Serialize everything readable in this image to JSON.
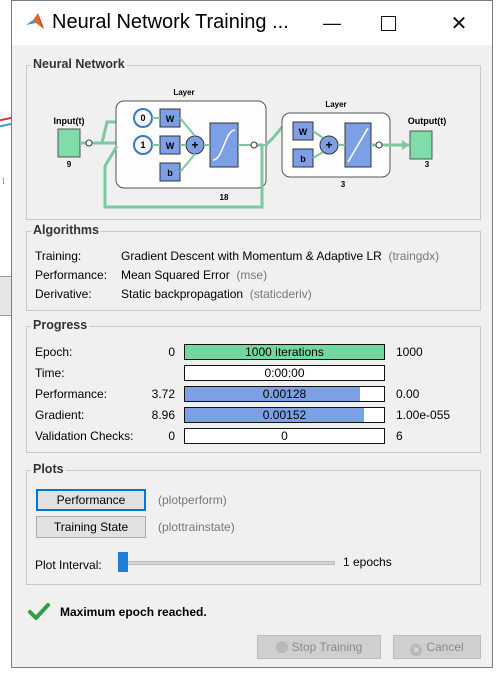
{
  "window": {
    "title": "Neural Network Training ..."
  },
  "network": {
    "section_title": "Neural Network",
    "input_label": "Input(t)",
    "input_size": "9",
    "hidden_layer_label": "Layer",
    "hidden_size": "18",
    "delay_0": "0",
    "delay_1": "1",
    "w": "W",
    "b": "b",
    "output_layer_label": "Layer",
    "output_layer_size": "3",
    "output_label": "Output(t)",
    "output_size": "3"
  },
  "algorithms": {
    "section_title": "Algorithms",
    "rows": [
      {
        "label": "Training:",
        "value": "Gradient Descent with Momentum & Adaptive LR",
        "code": "(traingdx)"
      },
      {
        "label": "Performance:",
        "value": "Mean Squared Error",
        "code": "(mse)"
      },
      {
        "label": "Derivative:",
        "value": "Static backpropagation",
        "code": "(staticderiv)"
      }
    ]
  },
  "progress": {
    "section_title": "Progress",
    "rows": [
      {
        "label": "Epoch:",
        "start": "0",
        "text": "1000 iterations",
        "end": "1000",
        "fill": 1.0,
        "color": "#72d8a0"
      },
      {
        "label": "Time:",
        "start": "",
        "text": "0:00:00",
        "end": "",
        "fill": 0.0,
        "color": "#ffffff"
      },
      {
        "label": "Performance:",
        "start": "3.72",
        "text": "0.00128",
        "end": "0.00",
        "fill": 0.88,
        "color": "#7d9fe6"
      },
      {
        "label": "Gradient:",
        "start": "8.96",
        "text": "0.00152",
        "end": "1.00e-055",
        "fill": 0.9,
        "color": "#7d9fe6"
      },
      {
        "label": "Validation Checks:",
        "start": "0",
        "text": "0",
        "end": "6",
        "fill": 0.0,
        "color": "#ffffff"
      }
    ]
  },
  "plots": {
    "section_title": "Plots",
    "performance_button": "Performance",
    "performance_code": "(plotperform)",
    "training_state_button": "Training State",
    "training_state_code": "(plottrainstate)",
    "interval_label": "Plot Interval:",
    "interval_value": "1 epochs",
    "interval_fraction": 0.0
  },
  "status": {
    "message": "Maximum epoch reached."
  },
  "footer": {
    "stop_label": "Stop Training",
    "cancel_label": "Cancel"
  },
  "colors": {
    "node_green": "#80dca8",
    "weight_blue": "#7d9fe6",
    "check_green": "#2ea043"
  }
}
